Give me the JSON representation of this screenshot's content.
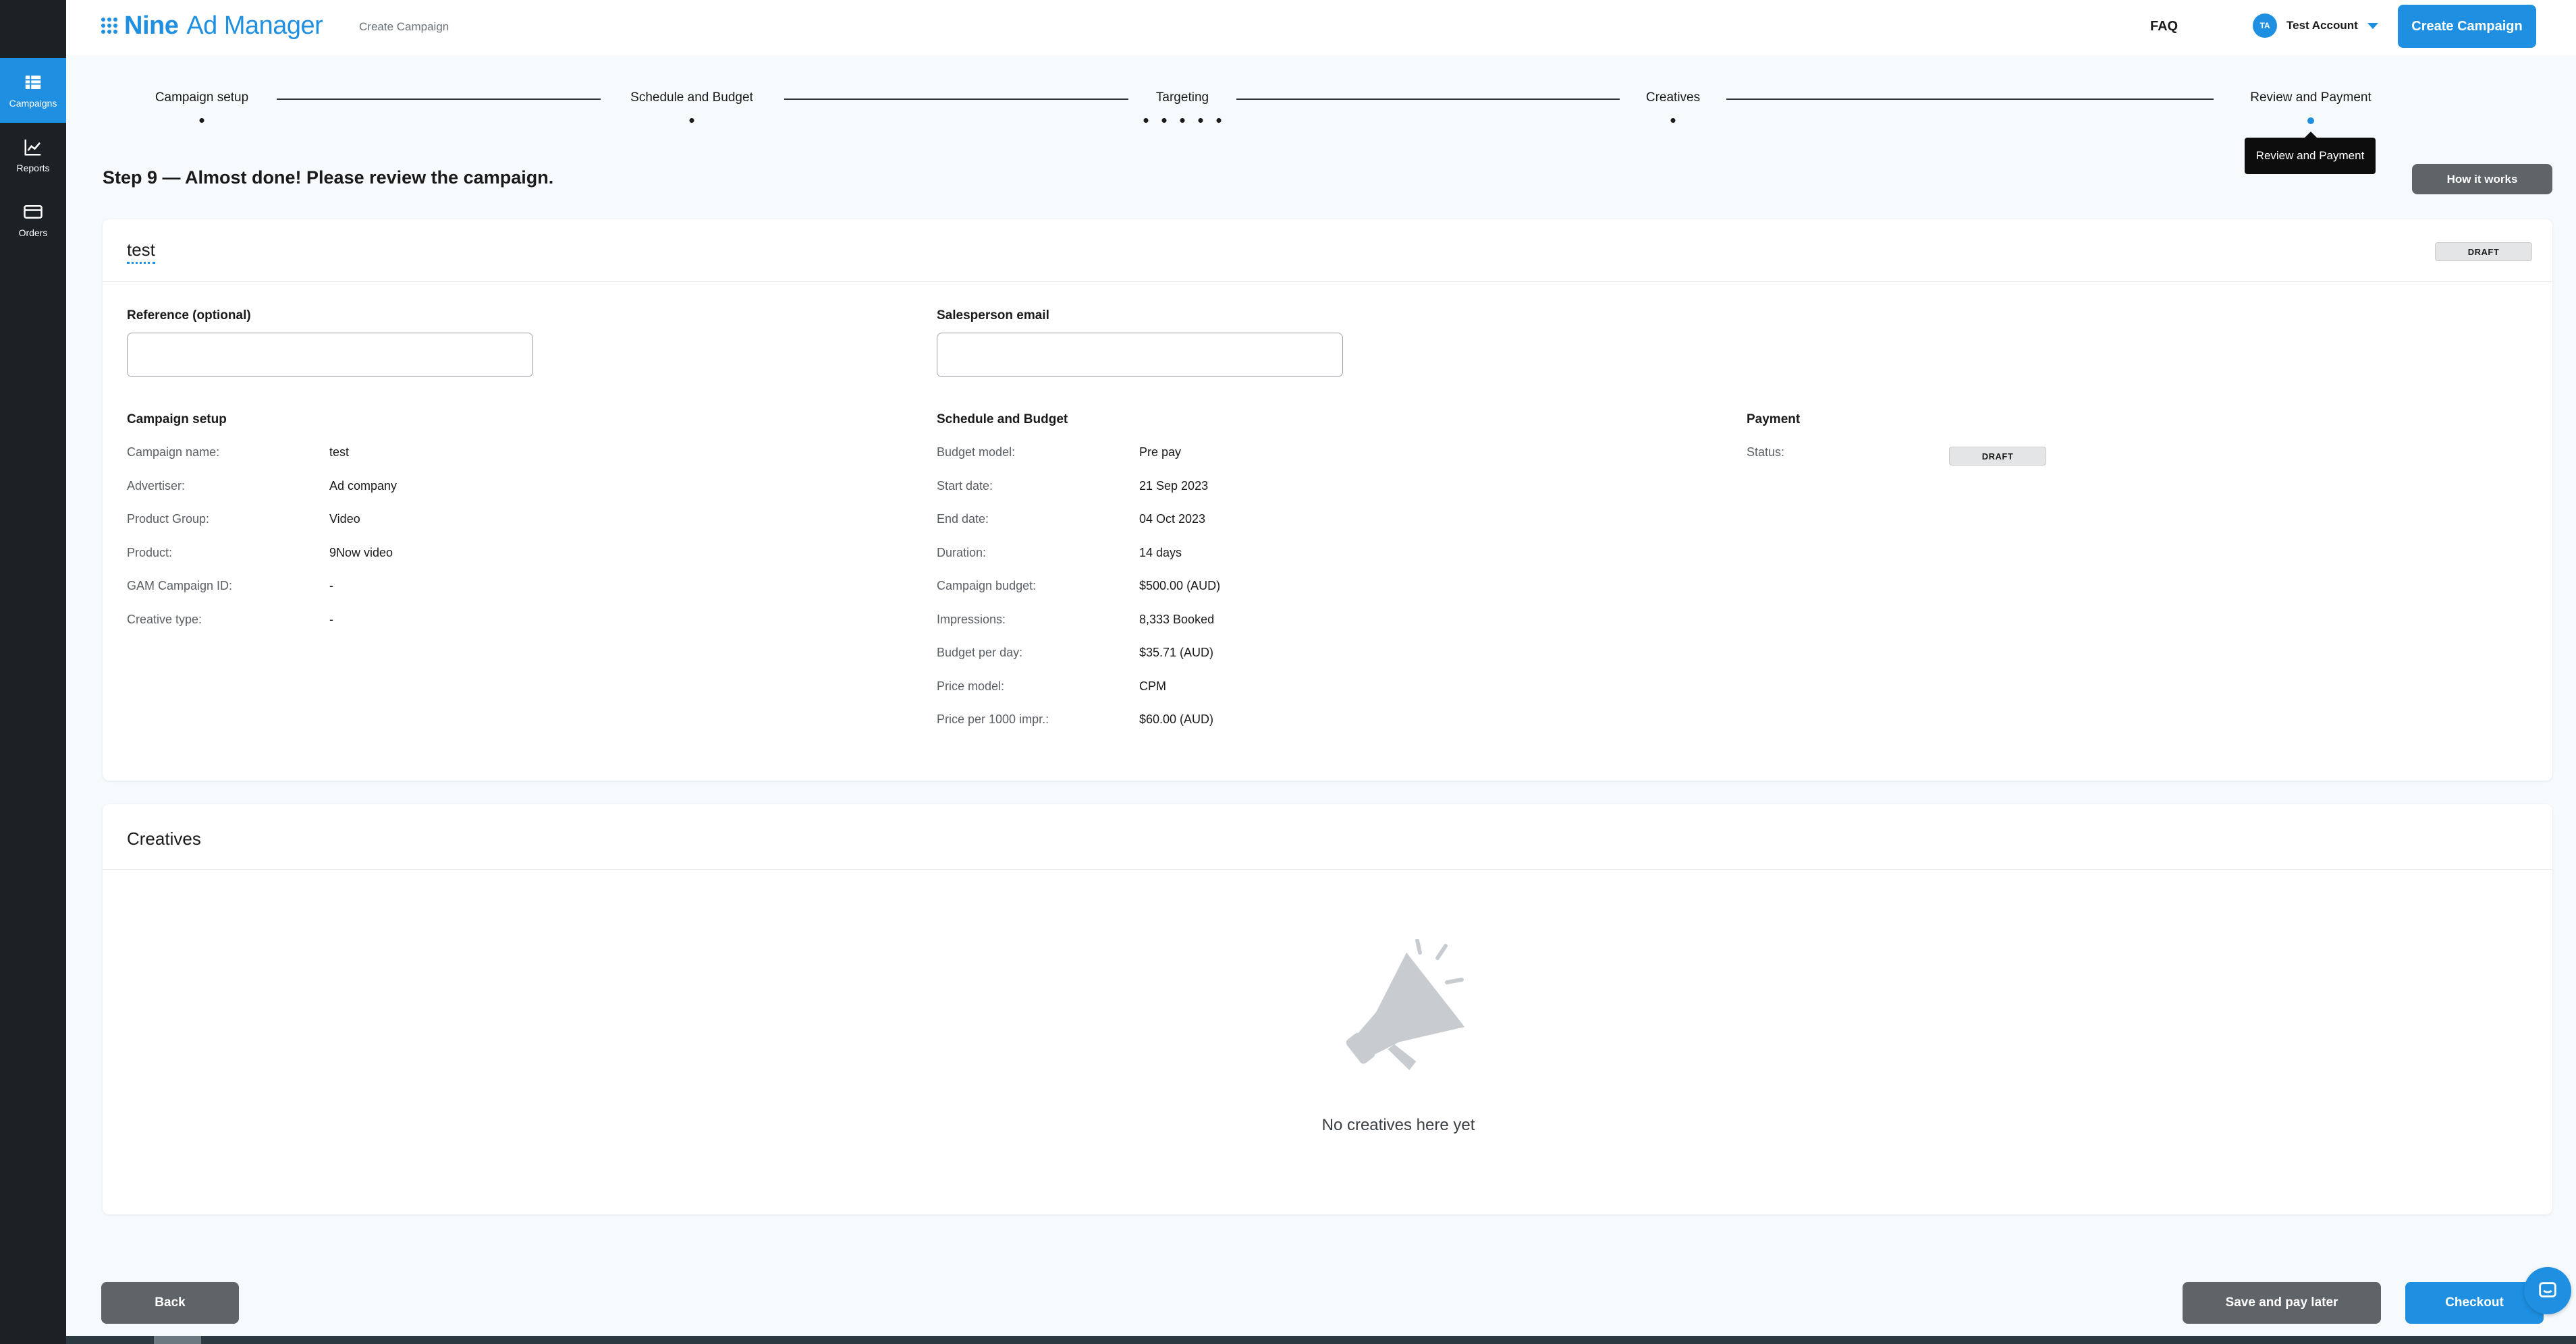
{
  "sidebar": {
    "items": [
      {
        "label": "Campaigns",
        "icon": "table-icon",
        "active": true
      },
      {
        "label": "Reports",
        "icon": "chart-icon",
        "active": false
      },
      {
        "label": "Orders",
        "icon": "card-icon",
        "active": false
      }
    ]
  },
  "header": {
    "logo_bold": "Nine",
    "logo_rest": " Ad Manager",
    "subtitle": "Create Campaign",
    "faq": "FAQ",
    "avatar_initials": "TA",
    "account_name": "Test Account",
    "create_button": "Create Campaign"
  },
  "stepper": {
    "steps": [
      "Campaign setup",
      "Schedule and Budget",
      "Targeting",
      "Creatives",
      "Review and Payment"
    ],
    "active_index": 4,
    "tooltip": "Review and Payment"
  },
  "page": {
    "heading": "Step 9 — Almost done! Please review the campaign.",
    "how_it_works": "How it works"
  },
  "campaign": {
    "name": "test",
    "status_badge": "DRAFT",
    "reference_label": "Reference (optional)",
    "reference_value": "",
    "salesperson_label": "Salesperson email",
    "salesperson_value": ""
  },
  "setup": {
    "title": "Campaign setup",
    "rows": [
      {
        "key": "Campaign name:",
        "value": "test"
      },
      {
        "key": "Advertiser:",
        "value": "Ad company"
      },
      {
        "key": "Product Group:",
        "value": "Video"
      },
      {
        "key": "Product:",
        "value": "9Now video"
      },
      {
        "key": "GAM Campaign ID:",
        "value": "-"
      },
      {
        "key": "Creative type:",
        "value": "-"
      }
    ]
  },
  "schedule": {
    "title": "Schedule and Budget",
    "rows": [
      {
        "key": "Budget model:",
        "value": "Pre pay"
      },
      {
        "key": "Start date:",
        "value": "21 Sep 2023"
      },
      {
        "key": "End date:",
        "value": "04 Oct 2023"
      },
      {
        "key": "Duration:",
        "value": "14 days"
      },
      {
        "key": "Campaign budget:",
        "value": "$500.00 (AUD)"
      },
      {
        "key": "Impressions:",
        "value": "8,333 Booked"
      },
      {
        "key": "Budget per day:",
        "value": "$35.71 (AUD)"
      },
      {
        "key": "Price model:",
        "value": "CPM"
      },
      {
        "key": "Price per 1000 impr.:",
        "value": "$60.00 (AUD)"
      }
    ]
  },
  "payment": {
    "title": "Payment",
    "status_key": "Status:",
    "status_badge": "DRAFT"
  },
  "creatives": {
    "title": "Creatives",
    "empty_text": "No creatives here yet",
    "empty_icon": "megaphone-icon"
  },
  "footer": {
    "back": "Back",
    "save_later": "Save and pay later",
    "checkout": "Checkout"
  },
  "colors": {
    "accent": "#1e8fe1",
    "sidebar": "#1b2124",
    "grey_button": "#5f6468"
  }
}
